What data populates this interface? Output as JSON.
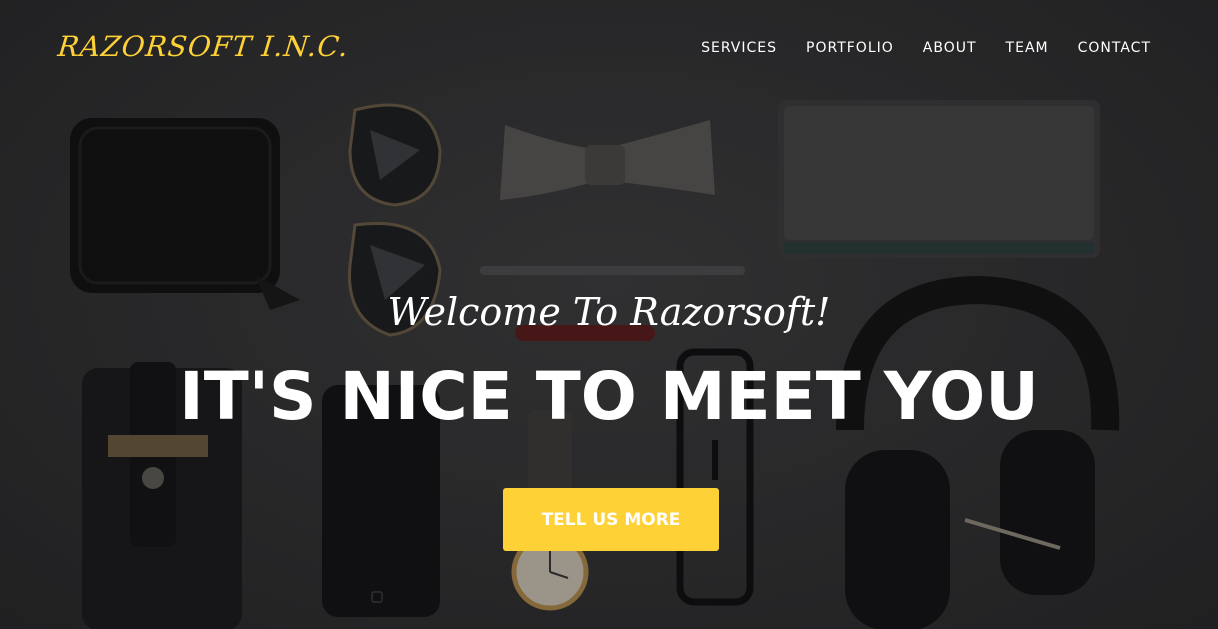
{
  "brand": {
    "name": "RAZORSOFT I.N.C."
  },
  "nav": {
    "items": [
      {
        "label": "SERVICES"
      },
      {
        "label": "PORTFOLIO"
      },
      {
        "label": "ABOUT"
      },
      {
        "label": "TEAM"
      },
      {
        "label": "CONTACT"
      }
    ]
  },
  "hero": {
    "lead": "Welcome To Razorsoft!",
    "heading": "IT'S NICE TO MEET YOU",
    "cta_label": "TELL US MORE"
  },
  "colors": {
    "accent": "#fed136",
    "background": "#2e2e2f",
    "text": "#ffffff"
  }
}
